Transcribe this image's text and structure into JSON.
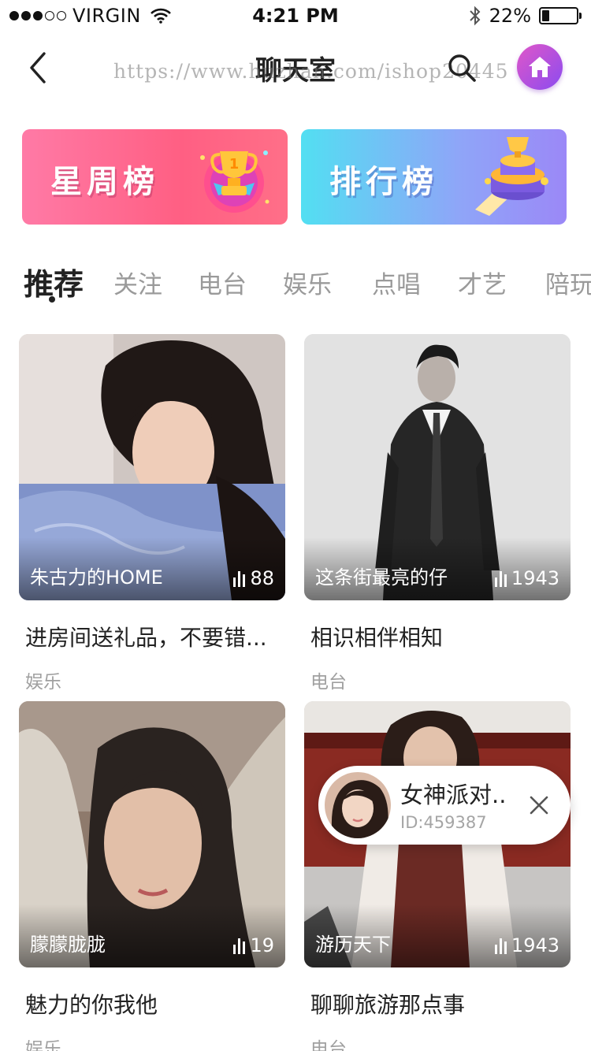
{
  "status_bar": {
    "carrier": "VIRGIN",
    "time": "4:21 PM",
    "battery_percent": "22%",
    "battery_level": 0.22,
    "signal_icon": "signal-dots-icon",
    "wifi_icon": "wifi-icon",
    "bluetooth_icon": "bluetooth-icon"
  },
  "nav": {
    "title": "聊天室",
    "watermark": "https://www.huzhan.com/ishop20445",
    "back_icon": "chevron-left-icon",
    "search_icon": "search-icon",
    "home_icon": "home-icon"
  },
  "banners": [
    {
      "label": "星周榜",
      "icon": "trophy-icon",
      "color": "#ff6489"
    },
    {
      "label": "排行榜",
      "icon": "podium-icon",
      "color": "#72bdf6"
    }
  ],
  "tabs": [
    {
      "label": "推荐",
      "active": true
    },
    {
      "label": "关注"
    },
    {
      "label": "电台"
    },
    {
      "label": "娱乐"
    },
    {
      "label": "点唱"
    },
    {
      "label": "才艺"
    },
    {
      "label": "陪玩"
    }
  ],
  "cards": [
    {
      "room_name": "朱古力的HOME",
      "listeners": "88",
      "title": "进房间送礼品，不要错...",
      "category": "娱乐"
    },
    {
      "room_name": "这条街最亮的仔",
      "listeners": "1943",
      "title": "相识相伴相知",
      "category": "电台"
    },
    {
      "room_name": "朦朦胧胧",
      "listeners": "19",
      "title": "魅力的你我他",
      "category": "娱乐"
    },
    {
      "room_name": "游历天下",
      "listeners": "1943",
      "title": "聊聊旅游那点事",
      "category": "电台"
    }
  ],
  "popup": {
    "name": "女神派对..",
    "id": "ID:459387",
    "close_icon": "close-icon"
  }
}
